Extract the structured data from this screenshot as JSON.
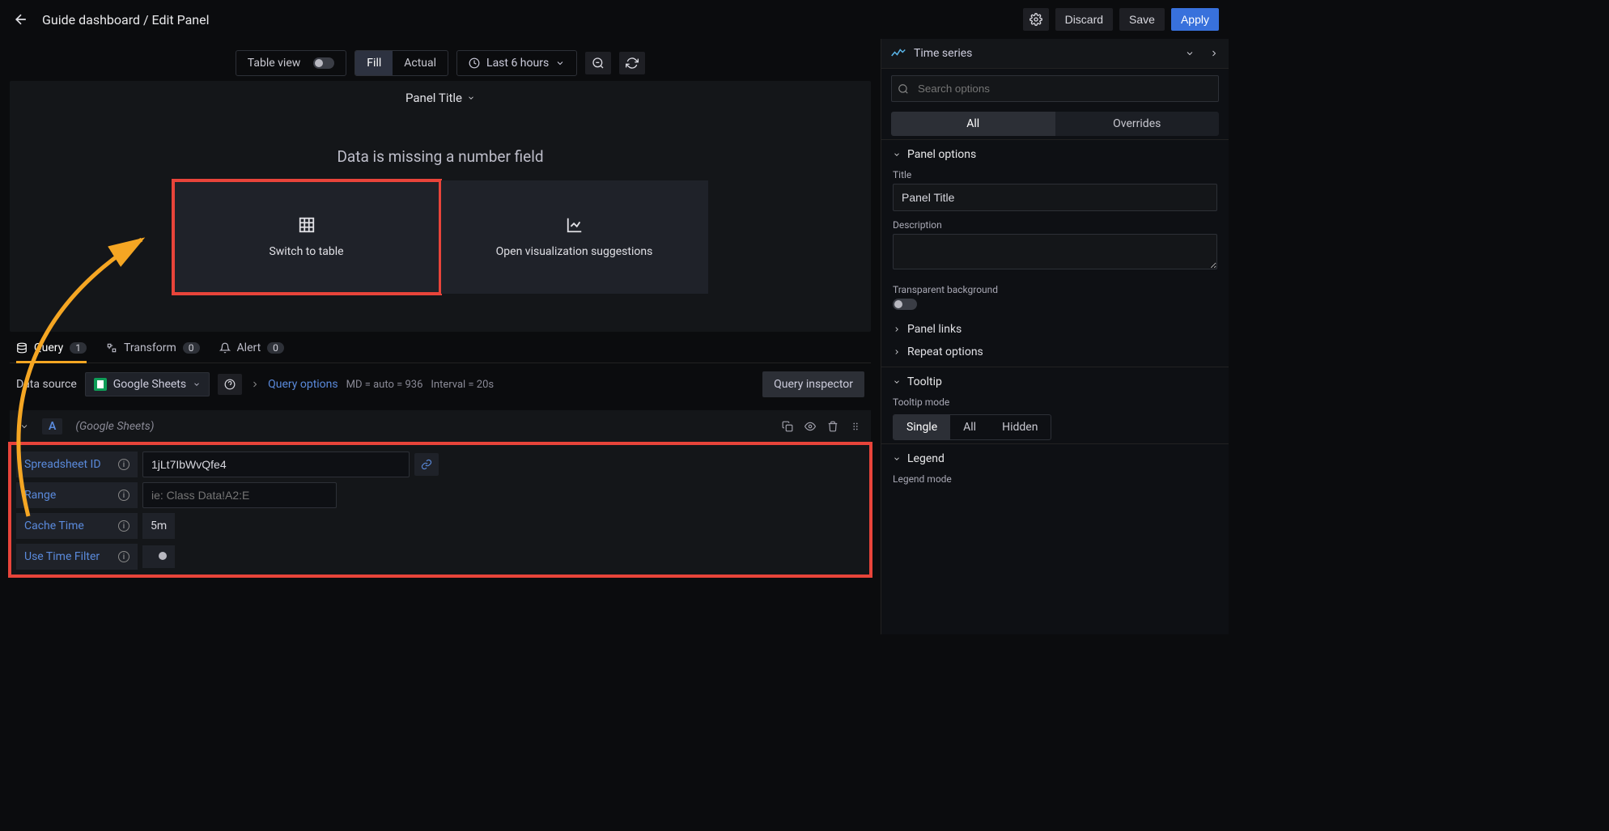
{
  "breadcrumb": "Guide dashboard / Edit Panel",
  "topActions": {
    "discard": "Discard",
    "save": "Save",
    "apply": "Apply"
  },
  "controls": {
    "tableView": "Table view",
    "fill": "Fill",
    "actual": "Actual",
    "timeRange": "Last 6 hours"
  },
  "panel": {
    "title": "Panel Title",
    "missing": "Data is missing a number field",
    "switchTable": "Switch to table",
    "openSuggestions": "Open visualization suggestions"
  },
  "tabs": {
    "query": "Query",
    "queryCount": "1",
    "transform": "Transform",
    "transformCount": "0",
    "alert": "Alert",
    "alertCount": "0"
  },
  "ds": {
    "label": "Data source",
    "name": "Google Sheets",
    "queryOptions": "Query options",
    "mdInfo": "MD = auto = 936",
    "intervalInfo": "Interval = 20s",
    "inspector": "Query inspector"
  },
  "query": {
    "letter": "A",
    "source": "(Google Sheets)",
    "fields": {
      "spreadsheetId": {
        "label": "Spreadsheet ID",
        "value": "1jLt7IbWvQfe4"
      },
      "range": {
        "label": "Range",
        "placeholder": "ie: Class Data!A2:E"
      },
      "cacheTime": {
        "label": "Cache Time",
        "value": "5m"
      },
      "useTimeFilter": {
        "label": "Use Time Filter"
      }
    }
  },
  "vizPicker": "Time series",
  "search": {
    "placeholder": "Search options"
  },
  "segTabs": {
    "all": "All",
    "overrides": "Overrides"
  },
  "options": {
    "panelOptions": "Panel options",
    "titleLabel": "Title",
    "titleValue": "Panel Title",
    "descLabel": "Description",
    "transparent": "Transparent background",
    "panelLinks": "Panel links",
    "repeat": "Repeat options",
    "tooltip": "Tooltip",
    "tooltipMode": "Tooltip mode",
    "modes": {
      "single": "Single",
      "all": "All",
      "hidden": "Hidden"
    },
    "legend": "Legend",
    "legendMode": "Legend mode"
  }
}
